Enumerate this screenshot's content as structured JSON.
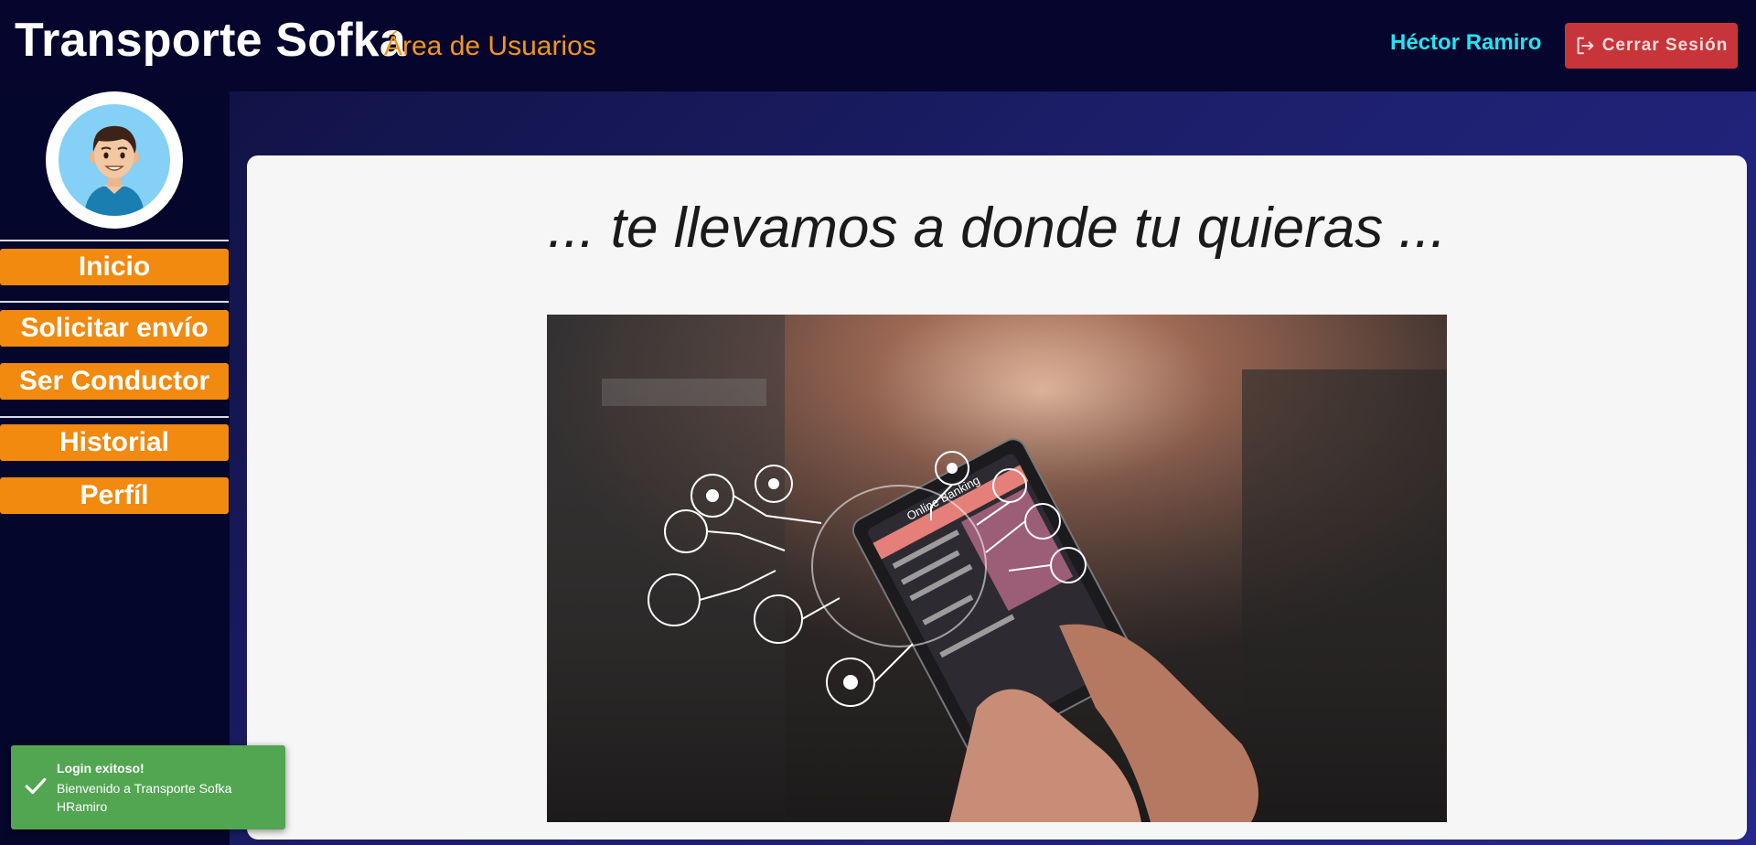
{
  "header": {
    "brand": "Transporte Sofka",
    "section": "Área de Usuarios",
    "user_name": "Héctor Ramiro",
    "logout_label": "Cerrar Sesión"
  },
  "sidebar": {
    "avatar_icon": "user-avatar-icon",
    "items": [
      {
        "label": "Inicio"
      },
      {
        "label": "Solicitar envío"
      },
      {
        "label": "Ser Conductor"
      },
      {
        "label": "Historial"
      },
      {
        "label": "Perfíl"
      }
    ]
  },
  "main": {
    "tagline": "... te llevamos a donde tu quieras ...",
    "hero_screen_title": "Online Banking"
  },
  "toast": {
    "icon": "check-icon",
    "title": "Login exitoso!",
    "message_line1": "Bienvenido a Transporte Sofka",
    "message_line2": "HRamiro"
  },
  "colors": {
    "header_bg": "#05052d",
    "accent_orange": "#f18a0f",
    "user_cyan": "#25e3f1",
    "logout_red": "#c7353a",
    "toast_green": "#52a652"
  }
}
